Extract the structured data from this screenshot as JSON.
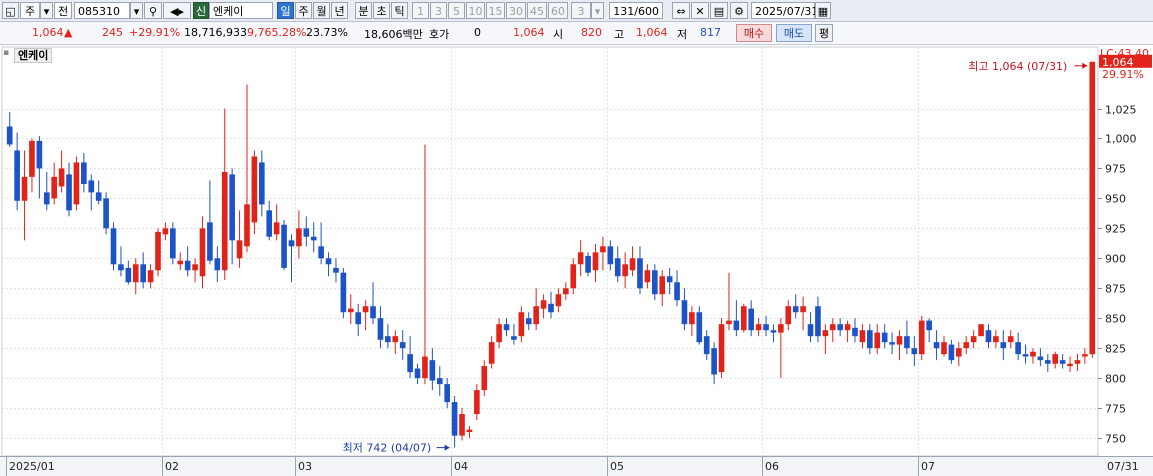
{
  "toolbar": {
    "period_type": "주",
    "prev": "전",
    "code": "085310",
    "new_badge": "신",
    "name": "엔케이",
    "period_buttons": [
      "일",
      "주",
      "월",
      "년",
      "분",
      "초",
      "틱"
    ],
    "tick_numbers": [
      "1",
      "3",
      "5",
      "10",
      "15",
      "30",
      "45",
      "60"
    ],
    "count_value": "3",
    "paging": "131/600",
    "date": "2025/07/31"
  },
  "quote": {
    "price": "1,064",
    "change": "245",
    "change_pct": "+29.91%",
    "volume": "18,716,933",
    "volume_ratio": "9,765.28%",
    "turnover": "23.73%",
    "amount": "18,606백만",
    "hoga_label": "호가",
    "hoga_value": "0",
    "hoga_price": "1,064",
    "open_label": "시",
    "open": "820",
    "high_label": "고",
    "high": "1,064",
    "low_label": "저",
    "low": "817",
    "buy_label": "매수",
    "sell_label": "매도",
    "eval_label": "평"
  },
  "chart_data": {
    "type": "candlestick",
    "title": "엔케이",
    "ylim": [
      735,
      1068
    ],
    "y_ticks": [
      750,
      775,
      800,
      825,
      850,
      875,
      900,
      925,
      950,
      975,
      1000,
      1025
    ],
    "x_labels": [
      "2025/01",
      "02",
      "03",
      "04",
      "05",
      "06",
      "07",
      "07/31"
    ],
    "upper_label": "LC:43.40",
    "last_price_label": "1,064",
    "last_pct_label": "29.91%",
    "high_annotation": "최고 1,064 (07/31)",
    "low_annotation": "최저 742 (04/07)",
    "colors": {
      "up": "#e0241a",
      "down": "#1c53c7"
    },
    "candles": [
      [
        1010,
        1022,
        993,
        995
      ],
      [
        990,
        1005,
        940,
        948
      ],
      [
        948,
        990,
        915,
        968
      ],
      [
        968,
        1000,
        955,
        998
      ],
      [
        998,
        1002,
        950,
        975
      ],
      [
        955,
        972,
        940,
        945
      ],
      [
        950,
        980,
        945,
        968
      ],
      [
        960,
        990,
        955,
        975
      ],
      [
        970,
        980,
        935,
        940
      ],
      [
        945,
        985,
        940,
        980
      ],
      [
        980,
        988,
        955,
        962
      ],
      [
        965,
        970,
        940,
        955
      ],
      [
        955,
        965,
        945,
        948
      ],
      [
        950,
        955,
        920,
        925
      ],
      [
        925,
        930,
        890,
        895
      ],
      [
        895,
        910,
        885,
        890
      ],
      [
        892,
        898,
        878,
        880
      ],
      [
        880,
        900,
        870,
        895
      ],
      [
        895,
        905,
        875,
        880
      ],
      [
        880,
        895,
        875,
        890
      ],
      [
        890,
        925,
        885,
        922
      ],
      [
        920,
        930,
        915,
        925
      ],
      [
        925,
        930,
        895,
        900
      ],
      [
        895,
        905,
        890,
        898
      ],
      [
        898,
        910,
        885,
        890
      ],
      [
        890,
        900,
        880,
        895
      ],
      [
        885,
        935,
        875,
        925
      ],
      [
        930,
        965,
        895,
        898
      ],
      [
        900,
        910,
        880,
        890
      ],
      [
        890,
        1025,
        882,
        972
      ],
      [
        970,
        975,
        895,
        915
      ],
      [
        900,
        940,
        892,
        915
      ],
      [
        910,
        1045,
        905,
        945
      ],
      [
        930,
        990,
        920,
        985
      ],
      [
        980,
        990,
        935,
        945
      ],
      [
        940,
        948,
        915,
        918
      ],
      [
        920,
        945,
        915,
        930
      ],
      [
        928,
        932,
        890,
        892
      ],
      [
        915,
        920,
        880,
        910
      ],
      [
        910,
        940,
        900,
        925
      ],
      [
        925,
        935,
        910,
        918
      ],
      [
        918,
        930,
        905,
        915
      ],
      [
        910,
        930,
        895,
        900
      ],
      [
        900,
        905,
        885,
        895
      ],
      [
        892,
        900,
        880,
        888
      ],
      [
        888,
        892,
        850,
        855
      ],
      [
        855,
        870,
        845,
        858
      ],
      [
        855,
        862,
        835,
        845
      ],
      [
        855,
        865,
        840,
        860
      ],
      [
        860,
        880,
        845,
        850
      ],
      [
        850,
        860,
        825,
        832
      ],
      [
        835,
        845,
        825,
        830
      ],
      [
        830,
        840,
        820,
        835
      ],
      [
        830,
        840,
        815,
        825
      ],
      [
        820,
        835,
        800,
        805
      ],
      [
        808,
        812,
        795,
        800
      ],
      [
        800,
        995,
        795,
        818
      ],
      [
        815,
        825,
        790,
        798
      ],
      [
        800,
        810,
        785,
        795
      ],
      [
        795,
        800,
        775,
        780
      ],
      [
        780,
        785,
        742,
        752
      ],
      [
        752,
        775,
        748,
        770
      ],
      [
        755,
        760,
        750,
        757
      ],
      [
        770,
        795,
        765,
        790
      ],
      [
        790,
        815,
        785,
        810
      ],
      [
        812,
        835,
        808,
        830
      ],
      [
        830,
        850,
        825,
        845
      ],
      [
        845,
        850,
        835,
        840
      ],
      [
        835,
        845,
        828,
        832
      ],
      [
        835,
        860,
        830,
        855
      ],
      [
        850,
        855,
        840,
        845
      ],
      [
        845,
        875,
        840,
        860
      ],
      [
        858,
        870,
        850,
        865
      ],
      [
        862,
        872,
        850,
        855
      ],
      [
        860,
        875,
        855,
        870
      ],
      [
        870,
        880,
        865,
        875
      ],
      [
        875,
        900,
        870,
        895
      ],
      [
        895,
        915,
        885,
        905
      ],
      [
        902,
        905,
        885,
        888
      ],
      [
        890,
        912,
        880,
        905
      ],
      [
        905,
        918,
        890,
        910
      ],
      [
        910,
        915,
        890,
        895
      ],
      [
        900,
        910,
        880,
        885
      ],
      [
        885,
        905,
        875,
        895
      ],
      [
        890,
        910,
        885,
        900
      ],
      [
        900,
        910,
        870,
        875
      ],
      [
        880,
        895,
        875,
        890
      ],
      [
        890,
        895,
        865,
        870
      ],
      [
        870,
        890,
        860,
        885
      ],
      [
        885,
        892,
        870,
        880
      ],
      [
        880,
        890,
        860,
        865
      ],
      [
        865,
        875,
        840,
        845
      ],
      [
        845,
        860,
        835,
        855
      ],
      [
        855,
        860,
        828,
        830
      ],
      [
        835,
        840,
        815,
        820
      ],
      [
        825,
        830,
        795,
        803
      ],
      [
        805,
        850,
        800,
        845
      ],
      [
        845,
        888,
        840,
        848
      ],
      [
        848,
        865,
        835,
        840
      ],
      [
        840,
        862,
        838,
        860
      ],
      [
        858,
        865,
        835,
        840
      ],
      [
        840,
        850,
        835,
        845
      ],
      [
        845,
        852,
        835,
        840
      ],
      [
        840,
        845,
        830,
        838
      ],
      [
        838,
        850,
        800,
        845
      ],
      [
        845,
        865,
        840,
        860
      ],
      [
        860,
        870,
        850,
        855
      ],
      [
        855,
        868,
        840,
        860
      ],
      [
        845,
        855,
        830,
        835
      ],
      [
        860,
        868,
        830,
        835
      ],
      [
        835,
        845,
        820,
        840
      ],
      [
        840,
        850,
        830,
        845
      ],
      [
        845,
        850,
        835,
        840
      ],
      [
        840,
        848,
        830,
        845
      ],
      [
        842,
        850,
        830,
        835
      ],
      [
        830,
        845,
        825,
        840
      ],
      [
        840,
        845,
        820,
        825
      ],
      [
        825,
        845,
        820,
        838
      ],
      [
        838,
        845,
        825,
        830
      ],
      [
        830,
        838,
        820,
        828
      ],
      [
        828,
        840,
        815,
        835
      ],
      [
        835,
        848,
        820,
        825
      ],
      [
        825,
        835,
        810,
        820
      ],
      [
        820,
        852,
        815,
        848
      ],
      [
        848,
        850,
        830,
        840
      ],
      [
        830,
        840,
        815,
        825
      ],
      [
        820,
        835,
        818,
        830
      ],
      [
        828,
        832,
        812,
        815
      ],
      [
        818,
        830,
        810,
        825
      ],
      [
        825,
        835,
        820,
        830
      ],
      [
        830,
        840,
        825,
        835
      ],
      [
        835,
        845,
        835,
        845
      ],
      [
        840,
        845,
        825,
        830
      ],
      [
        830,
        840,
        825,
        835
      ],
      [
        830,
        840,
        815,
        825
      ],
      [
        830,
        840,
        825,
        835
      ],
      [
        830,
        838,
        815,
        820
      ],
      [
        820,
        828,
        812,
        818
      ],
      [
        818,
        825,
        812,
        822
      ],
      [
        818,
        825,
        810,
        815
      ],
      [
        815,
        820,
        805,
        812
      ],
      [
        812,
        822,
        808,
        820
      ],
      [
        815,
        820,
        808,
        812
      ],
      [
        810,
        818,
        805,
        812
      ],
      [
        812,
        820,
        806,
        815
      ],
      [
        818,
        825,
        812,
        820
      ],
      [
        820,
        1064,
        817,
        1064
      ]
    ]
  }
}
